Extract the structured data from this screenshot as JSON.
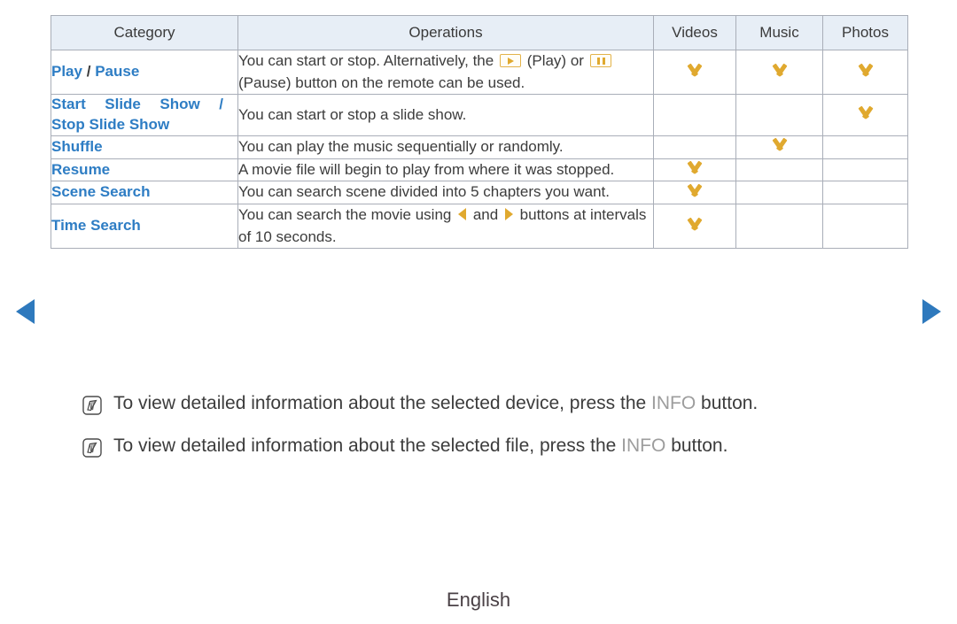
{
  "nav": {
    "prev_icon": "triangle-left-icon",
    "next_icon": "triangle-right-icon",
    "arrow_color": "#2e79bd"
  },
  "table": {
    "headers": {
      "category": "Category",
      "operations": "Operations",
      "videos": "Videos",
      "music": "Music",
      "photos": "Photos"
    },
    "check_icon": "chevron-down-check-icon",
    "check_color": "#e0a92f",
    "rows": [
      {
        "category": "Play / Pause",
        "category_parts": [
          "Play",
          "/",
          "Pause"
        ],
        "operations_line1_a": "You can start or stop. Alternatively, the",
        "operations_line1_b": "(Play) or",
        "operations_line2_b": "(Pause) button on the remote can be used.",
        "icons": [
          "play-key-icon",
          "pause-key-icon"
        ],
        "videos": true,
        "music": true,
        "photos": true
      },
      {
        "category_line1": "Start Slide Show /",
        "category_line2": "Stop Slide Show",
        "operations": "You can start or stop a slide show.",
        "videos": false,
        "music": false,
        "photos": true
      },
      {
        "category": "Shuffle",
        "operations": "You can play the music sequentially or randomly.",
        "videos": false,
        "music": true,
        "photos": false
      },
      {
        "category": "Resume",
        "operations": "A movie file will begin to play from where it was stopped.",
        "videos": true,
        "music": false,
        "photos": false
      },
      {
        "category": "Scene Search",
        "operations": "You can search scene divided into 5 chapters you want.",
        "videos": true,
        "music": false,
        "photos": false
      },
      {
        "category": "Time Search",
        "operations_a": "You can search the movie using",
        "operations_b": "and",
        "operations_c": "buttons at intervals of 10 seconds.",
        "icons": [
          "triangle-left-amber-icon",
          "triangle-right-amber-icon"
        ],
        "videos": true,
        "music": false,
        "photos": false
      }
    ]
  },
  "notes": [
    {
      "icon": "note-pencil-icon",
      "text_before": "To view detailed information about the selected device, press the",
      "highlight": "INFO",
      "text_after": "button."
    },
    {
      "icon": "note-pencil-icon",
      "text_before": "To view detailed information about the selected file, press the",
      "highlight": "INFO",
      "text_after": "button."
    }
  ],
  "footer": {
    "language": "English"
  },
  "colors": {
    "category_blue": "#2e7dc4",
    "amber": "#e0a92f",
    "header_bg": "#e7eef6",
    "border": "#a9aeb8",
    "info_gray": "#9d9d9d"
  }
}
